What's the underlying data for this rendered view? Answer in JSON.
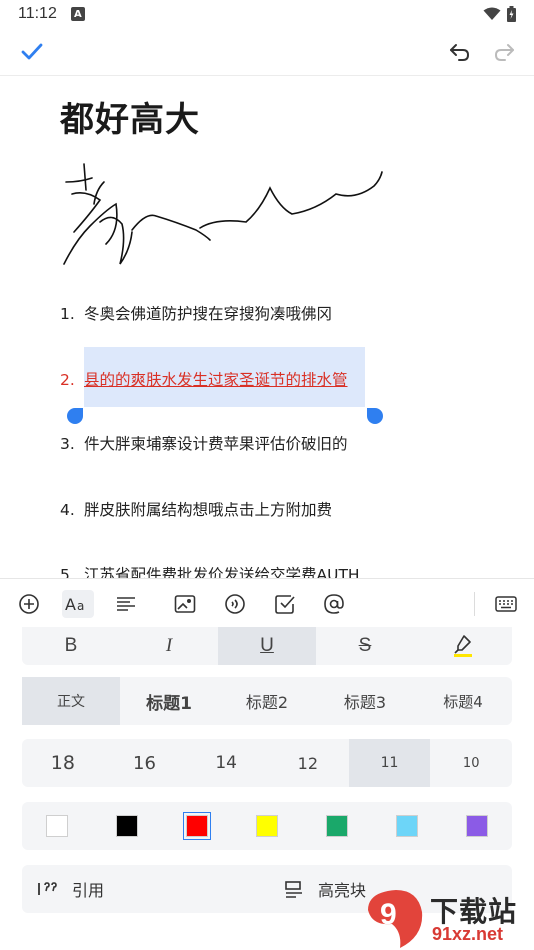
{
  "status": {
    "time": "11:12",
    "notification_badge": "A"
  },
  "document": {
    "title": "都好高大",
    "list": [
      {
        "num": "1.",
        "text": "冬奥会佛道防护搜在穿搜狗凑哦佛冈"
      },
      {
        "num": "2.",
        "text": "县的的爽肤水发生过家圣诞节的排水管"
      },
      {
        "num": "3.",
        "text": "件大胖柬埔寨设计费苹果评估价破旧的"
      },
      {
        "num": "4.",
        "text": "胖皮肤附属结构想哦点击上方附加费"
      },
      {
        "num": "5.",
        "text": "江苏省配件费批发价发送给交学费AUTH"
      }
    ]
  },
  "style_row": {
    "bold": "B",
    "italic": "I",
    "underline": "U",
    "strike": "S"
  },
  "headings": [
    "正文",
    "标题1",
    "标题2",
    "标题3",
    "标题4"
  ],
  "font_sizes": [
    "18",
    "16",
    "14",
    "12",
    "11",
    "10"
  ],
  "colors": [
    "#ffffff",
    "#000000",
    "#ff0000",
    "#ffff00",
    "#1aa86a",
    "#6dd5f8",
    "#8b5be6"
  ],
  "blocks": {
    "quote": "引用",
    "highlight": "高亮块"
  },
  "watermark": {
    "brand": "下载站",
    "domain": "91xz.net",
    "logo_digit": "9"
  }
}
